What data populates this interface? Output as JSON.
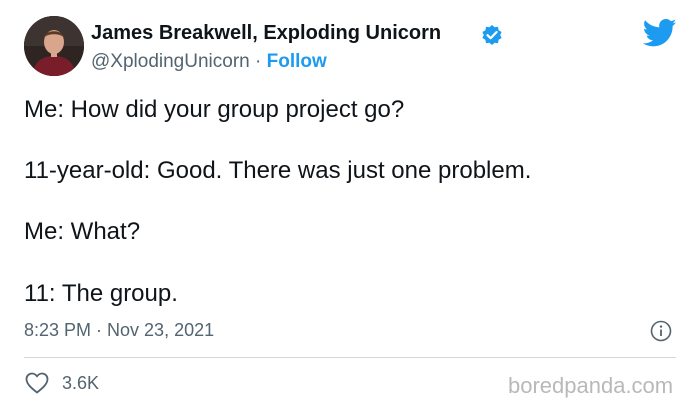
{
  "author": {
    "name": "James Breakwell, Exploding Unicorn",
    "handle": "@XplodingUnicorn",
    "separator": "·",
    "follow_label": "Follow"
  },
  "tweet": {
    "lines": [
      "Me: How did your group project go?",
      "11-year-old: Good. There was just one problem.",
      "Me: What?",
      "11: The group."
    ],
    "timestamp": "8:23 PM · Nov 23, 2021",
    "likes": "3.6K"
  },
  "watermark": "boredpanda.com",
  "icons": {
    "avatar": "avatar-photo",
    "verified": "verified-badge-icon",
    "brand": "twitter-bird-icon",
    "info": "info-icon",
    "like": "heart-icon"
  },
  "colors": {
    "accent": "#1d9bf0",
    "text": "#0f1419",
    "muted": "#536471",
    "divider": "#cfd9de"
  }
}
